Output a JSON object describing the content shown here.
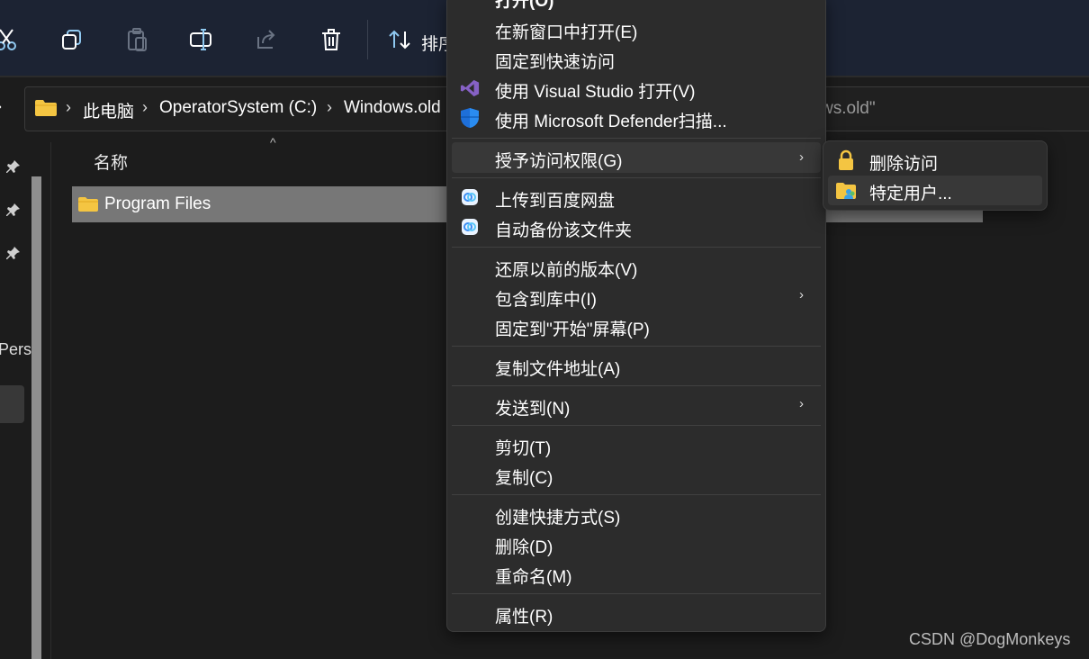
{
  "toolbar": {
    "icons": [
      "cut-icon",
      "copy-icon",
      "paste-icon",
      "rename-icon",
      "share-icon",
      "delete-icon",
      "sort-icon"
    ],
    "sort_label": "排序"
  },
  "address": {
    "crumbs": [
      "此电脑",
      "OperatorSystem (C:)",
      "Windows.old"
    ],
    "search_placeholder": "ws.old\""
  },
  "nav": {
    "partial_label": "Pers"
  },
  "list": {
    "column_name": "名称",
    "rows": [
      {
        "name": "Program Files"
      }
    ]
  },
  "context_menu": {
    "items": {
      "open": "打开(O)",
      "open_new_window": "在新窗口中打开(E)",
      "pin_quick_access": "固定到快速访问",
      "open_vs": "使用 Visual Studio 打开(V)",
      "defender_scan": "使用 Microsoft Defender扫描...",
      "give_access": "授予访问权限(G)",
      "upload_baidu": "上传到百度网盘",
      "auto_backup": "自动备份该文件夹",
      "restore_prev": "还原以前的版本(V)",
      "include_library": "包含到库中(I)",
      "pin_start": "固定到\"开始\"屏幕(P)",
      "copy_path": "复制文件地址(A)",
      "send_to": "发送到(N)",
      "cut": "剪切(T)",
      "copy": "复制(C)",
      "create_shortcut": "创建快捷方式(S)",
      "delete": "删除(D)",
      "rename": "重命名(M)",
      "properties": "属性(R)"
    }
  },
  "submenu": {
    "remove_access": "删除访问",
    "specific_users": "特定用户..."
  },
  "watermark": "CSDN @DogMonkeys",
  "colors": {
    "folder": "#f4c542",
    "accent": "#4a90d9",
    "vs_purple": "#8661c5",
    "defender_blue": "#1e6fd9"
  }
}
